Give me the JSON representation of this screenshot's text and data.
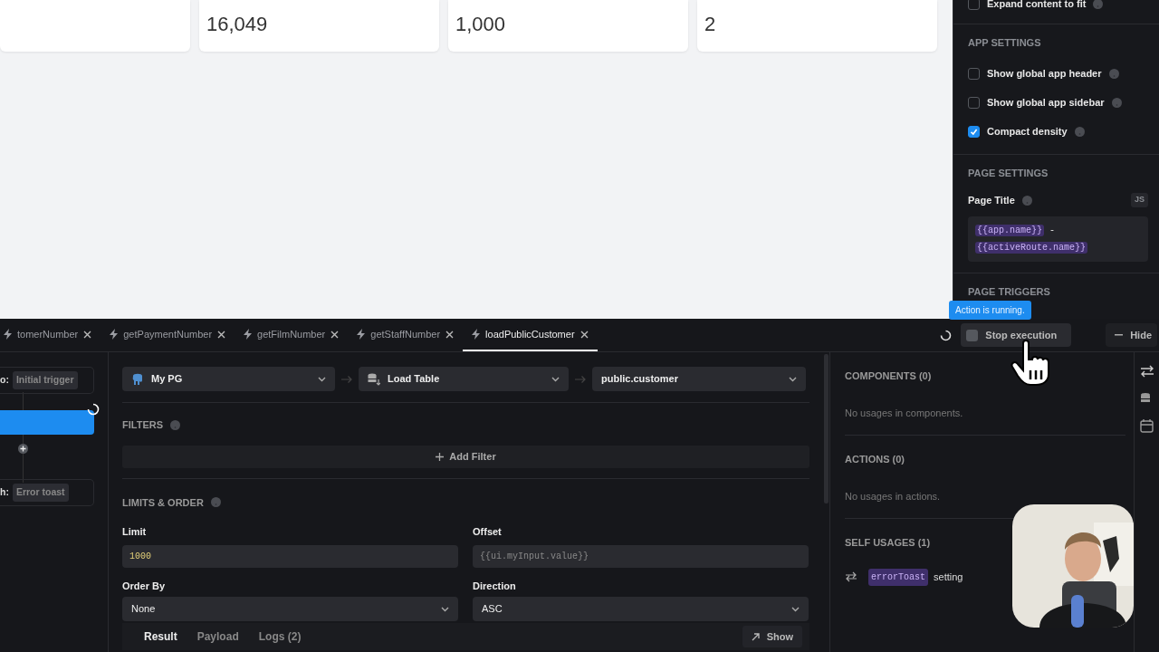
{
  "stat_cards": [
    {
      "value": "16,049"
    },
    {
      "value": "1,000"
    },
    {
      "value": "2"
    }
  ],
  "settings": {
    "expand": {
      "label": "Expand content to fit",
      "checked": false
    },
    "app_settings": {
      "title": "APP SETTINGS",
      "options": [
        {
          "label": "Show global app header",
          "checked": false
        },
        {
          "label": "Show global app sidebar",
          "checked": false
        },
        {
          "label": "Compact density",
          "checked": true
        }
      ]
    },
    "page_settings": {
      "title": "PAGE SETTINGS",
      "field_label": "Page Title",
      "js_badge": "JS",
      "code_chips": [
        "{{app.name}}",
        "{{activeRoute.name}}"
      ],
      "separator": "-"
    },
    "page_triggers": {
      "title": "PAGE TRIGGERS"
    }
  },
  "tooltip": "Action is running.",
  "query_tabs": [
    {
      "label": "tomerNumber",
      "selected": false
    },
    {
      "label": "getPaymentNumber",
      "selected": false
    },
    {
      "label": "getFilmNumber",
      "selected": false
    },
    {
      "label": "getStaffNumber",
      "selected": false
    },
    {
      "label": "loadPublicCustomer",
      "selected": true
    }
  ],
  "stop_button": "Stop execution",
  "hide_button": "Hide",
  "flow": {
    "trigger_label": "o:",
    "trigger_chip": "Initial trigger",
    "error_label": "h:",
    "error_chip": "Error toast"
  },
  "selects": [
    {
      "value": "My PG",
      "kind": "datasource"
    },
    {
      "value": "Load Table",
      "kind": "action"
    },
    {
      "value": "public.customer",
      "kind": "table"
    }
  ],
  "filters": {
    "title": "FILTERS",
    "add": "Add Filter"
  },
  "limits": {
    "title": "LIMITS & ORDER",
    "fields": [
      {
        "label": "Limit",
        "value": "1000",
        "kind": "input"
      },
      {
        "label": "Offset",
        "placeholder": "{{ui.myInput.value}}",
        "kind": "input"
      },
      {
        "label": "Order By",
        "value": "None",
        "kind": "select"
      },
      {
        "label": "Direction",
        "value": "ASC",
        "kind": "select"
      }
    ]
  },
  "result_tabs": [
    {
      "label": "Result",
      "selected": true
    },
    {
      "label": "Payload",
      "selected": false
    },
    {
      "label": "Logs (2)",
      "selected": false
    }
  ],
  "show_button": "Show",
  "usages": [
    {
      "title": "COMPONENTS (0)",
      "empty": "No usages in components."
    },
    {
      "title": "ACTIONS (0)",
      "empty": "No usages in actions."
    },
    {
      "title": "SELF USAGES (1)",
      "items": [
        {
          "chip": "errorToast",
          "text": "setting"
        }
      ]
    }
  ]
}
